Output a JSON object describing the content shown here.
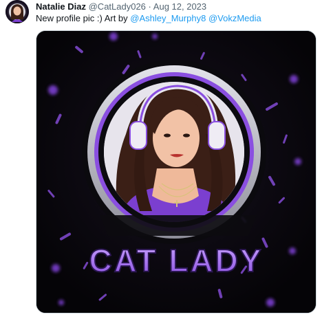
{
  "tweet": {
    "author_name": "Natalie Diaz",
    "handle": "@CatLady026",
    "separator": "·",
    "date": "Aug 12, 2023",
    "text_prefix": "New profile pic :) Art by ",
    "mention_1": "@Ashley_Murphy8",
    "mention_2": "@VokzMedia"
  },
  "media": {
    "logo_text": "CAT LADY",
    "colors": {
      "background": "#050407",
      "accent_purple": "#8a4fe0",
      "light_purple": "#b98cf5",
      "ring_gray": "#b9b9c4"
    }
  }
}
